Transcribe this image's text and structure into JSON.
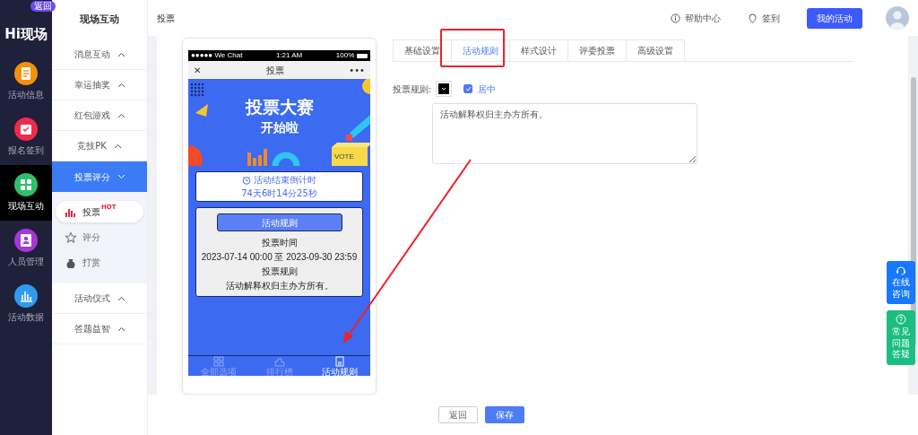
{
  "rail": {
    "logo": "Hi现场",
    "back_badge": "返回",
    "items": [
      {
        "label": "活动信息",
        "selected": false,
        "color": "#f5900d",
        "kind": "doc"
      },
      {
        "label": "报名签到",
        "selected": false,
        "color": "#ef2b4b",
        "kind": "calendar"
      },
      {
        "label": "现场互动",
        "selected": true,
        "color": "#2fbf6a",
        "kind": "tiles"
      },
      {
        "label": "人员管理",
        "selected": false,
        "color": "#a637d6",
        "kind": "person"
      },
      {
        "label": "活动数据",
        "selected": false,
        "color": "#2f9bf0",
        "kind": "bars"
      }
    ]
  },
  "menu": {
    "title": "现场互动",
    "groups": [
      {
        "label": "消息互动",
        "expanded": false,
        "selected": false
      },
      {
        "label": "幸运抽奖",
        "expanded": false,
        "selected": false
      },
      {
        "label": "红包游戏",
        "expanded": false,
        "selected": false
      },
      {
        "label": "竞技PK",
        "expanded": false,
        "selected": false
      },
      {
        "label": "投票评分",
        "expanded": true,
        "selected": true,
        "children": [
          {
            "label": "投票",
            "badge": "HOT",
            "selected": true,
            "kind": "chart"
          },
          {
            "label": "评分",
            "selected": false,
            "kind": "star"
          },
          {
            "label": "打赏",
            "selected": false,
            "kind": "bag"
          }
        ]
      },
      {
        "label": "活动仪式",
        "expanded": false,
        "selected": false
      },
      {
        "label": "答题益智",
        "expanded": false,
        "selected": false
      }
    ]
  },
  "topbar": {
    "breadcrumb": "投票",
    "links": [
      {
        "label": "帮助中心",
        "kind": "info"
      },
      {
        "label": "签到",
        "kind": "pin"
      }
    ],
    "primary_button": "我的活动"
  },
  "phone": {
    "status": {
      "carrier": "●●●●● We Chat",
      "time": "1:21 AM",
      "battery": "100%"
    },
    "nav": {
      "close": "✕",
      "title": "投票",
      "more": "•••"
    },
    "banner": {
      "title": "投票大赛",
      "subtitle": "开始啦",
      "box_label": "VOTE"
    },
    "countdown": {
      "label": "活动结束倒计时",
      "value": "74天6时14分25秒"
    },
    "rules": {
      "button": "活动规则",
      "lines": [
        "投票时间",
        "2023-07-14 00:00 至 2023-09-30 23:59",
        "投票规则",
        "活动解释权归主办方所有。"
      ]
    },
    "tabbar": [
      {
        "label": "全部选项",
        "selected": false,
        "kind": "grid"
      },
      {
        "label": "排行榜",
        "selected": false,
        "kind": "rank"
      },
      {
        "label": "活动规则",
        "selected": true,
        "kind": "doc"
      }
    ]
  },
  "settings": {
    "tabs": [
      {
        "label": "基础设置",
        "selected": false
      },
      {
        "label": "活动规则",
        "selected": true
      },
      {
        "label": "样式设计",
        "selected": false
      },
      {
        "label": "评委投票",
        "selected": false
      },
      {
        "label": "高级设置",
        "selected": false
      }
    ],
    "field_label": "投票规则:",
    "center_checkbox": {
      "label": "居中",
      "checked": true
    },
    "rules_text": "活动解释权归主办方所有。"
  },
  "footer": {
    "buttons": [
      {
        "label": "返回",
        "kind": "secondary"
      },
      {
        "label": "保存",
        "kind": "primary"
      }
    ]
  },
  "float_buttons": [
    {
      "label": "在线咨询",
      "kind": "headset",
      "color": "#1677ff"
    },
    {
      "label": "常见问题答疑",
      "kind": "help",
      "color": "#19be80"
    }
  ]
}
